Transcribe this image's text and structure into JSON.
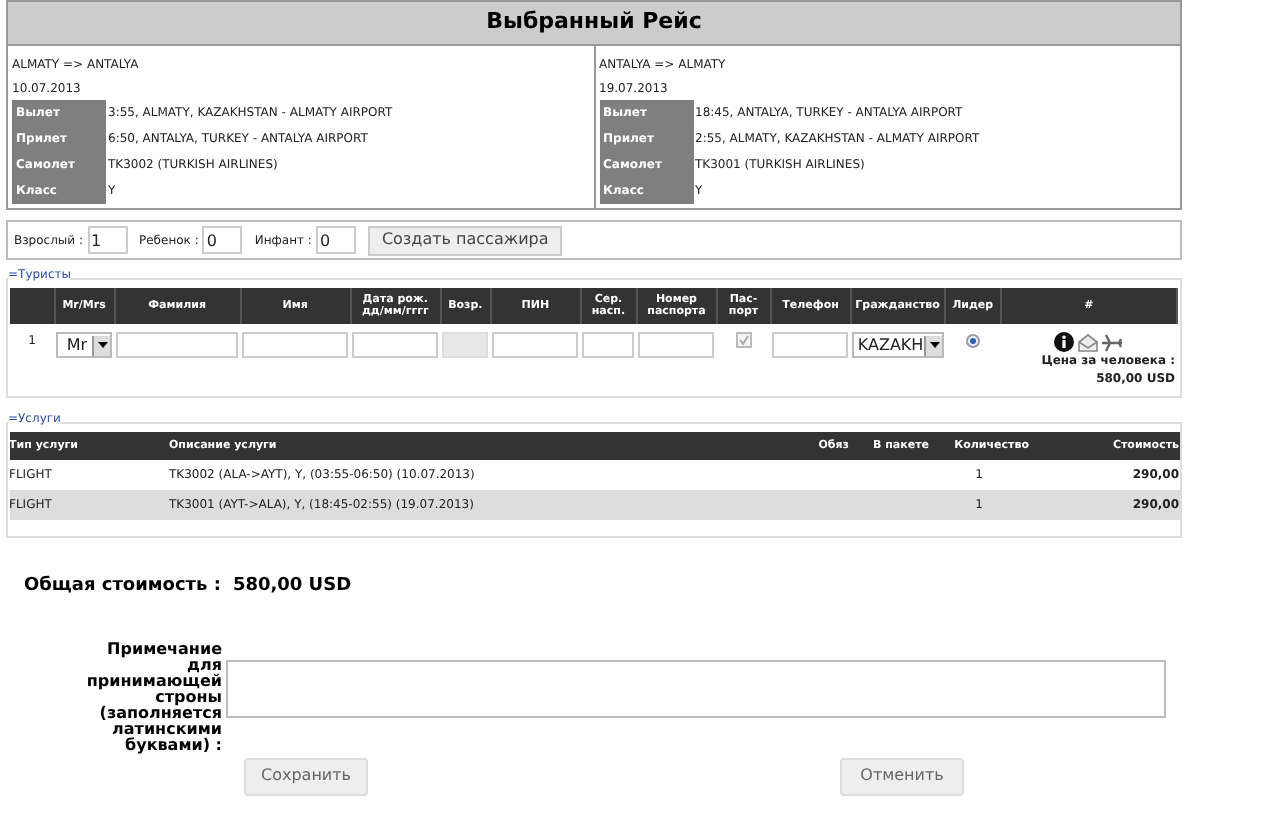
{
  "title": "Выбранный Рейс",
  "flights": [
    {
      "route": "ALMATY => ANTALYA",
      "date": "10.07.2013",
      "details": [
        {
          "label": "Вылет",
          "value": "3:55, ALMATY, KAZAKHSTAN - ALMATY AIRPORT"
        },
        {
          "label": "Прилет",
          "value": "6:50, ANTALYA, TURKEY - ANTALYA AIRPORT"
        },
        {
          "label": "Самолет",
          "value": "TK3002 (TURKISH AIRLINES)"
        },
        {
          "label": "Класс",
          "value": "Y"
        }
      ]
    },
    {
      "route": "ANTALYA => ALMATY",
      "date": "19.07.2013",
      "details": [
        {
          "label": "Вылет",
          "value": "18:45, ANTALYA, TURKEY - ANTALYA AIRPORT"
        },
        {
          "label": "Прилет",
          "value": "2:55, ALMATY, KAZAKHSTAN - ALMATY AIRPORT"
        },
        {
          "label": "Самолет",
          "value": "TK3001 (TURKISH AIRLINES)"
        },
        {
          "label": "Класс",
          "value": "Y"
        }
      ]
    }
  ],
  "passenger_counts": {
    "fields": [
      {
        "label": "Взрослый :",
        "value": "1"
      },
      {
        "label": "Ребенок :",
        "value": "0"
      },
      {
        "label": "Инфант :",
        "value": "0"
      }
    ],
    "button": "Создать пассажира"
  },
  "tourists": {
    "legend": "=Туристы",
    "columns": [
      {
        "kind": "number"
      },
      {
        "kind": "select",
        "label": "Mr/Mrs"
      },
      {
        "kind": "input",
        "label": "Фамилия"
      },
      {
        "kind": "input",
        "label": "Имя"
      },
      {
        "kind": "input",
        "label": "Дата рож. дд/мм/гггг"
      },
      {
        "kind": "disabled",
        "label": "Возр."
      },
      {
        "kind": "input",
        "label": "ПИН"
      },
      {
        "kind": "input",
        "label": "Сер. насп."
      },
      {
        "kind": "input",
        "label": "Номер паспорта"
      },
      {
        "kind": "checkbox",
        "label": "Пас- порт"
      },
      {
        "kind": "input",
        "label": "Телефон"
      },
      {
        "kind": "citizenship",
        "label": "Гражданство"
      },
      {
        "kind": "radio",
        "label": "Лидер"
      },
      {
        "kind": "actions",
        "label": "#"
      }
    ],
    "rows": [
      {
        "number": "1",
        "title": "Mr",
        "passport_checked": true,
        "citizenship": "KAZAKH",
        "leader_selected": true,
        "price_label": "Цена за человека :",
        "price": "580,00 USD"
      }
    ]
  },
  "services": {
    "legend": "=Услуги",
    "columns": [
      "Тип услуги",
      "Описание услуги",
      "Обяз",
      "В пакете",
      "Количество",
      "Стоимость"
    ],
    "rows": [
      {
        "type": "FLIGHT",
        "description": "TK3002 (ALA->AYT), Y, (03:55-06:50) (10.07.2013)",
        "quantity": "1",
        "cost": "290,00"
      },
      {
        "type": "FLIGHT",
        "description": "TK3001 (AYT->ALA), Y, (18:45-02:55) (19.07.2013)",
        "quantity": "1",
        "cost": "290,00"
      }
    ]
  },
  "total": {
    "label": "Общая стоимость :",
    "value": "580,00 USD"
  },
  "note": {
    "label": "Примечание для принимающей строны (заполняется латинскими буквами) :"
  },
  "buttons": [
    "Сохранить",
    "Отменить"
  ]
}
